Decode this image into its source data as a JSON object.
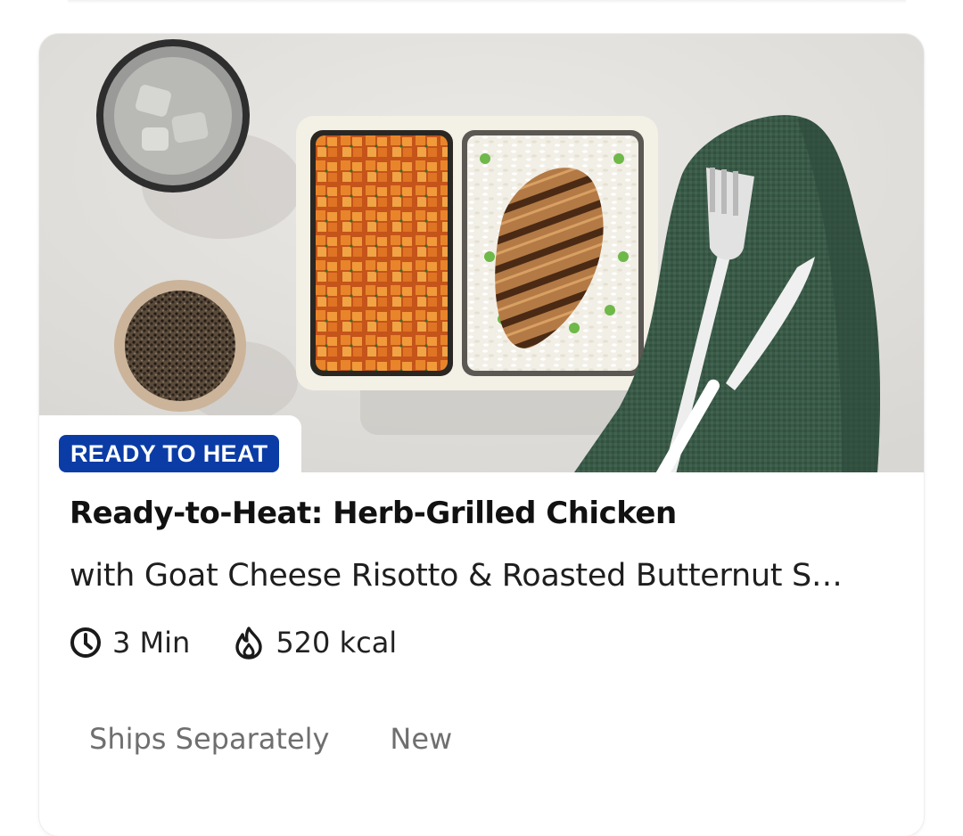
{
  "card": {
    "badge": "READY TO HEAT",
    "title": "Ready-to-Heat: Herb-Grilled Chicken",
    "subtitle": "with Goat Cheese Risotto & Roasted Butternut S…",
    "prep_time": "3 Min",
    "calories": "520 kcal",
    "prep_time_icon": "clock-icon",
    "calories_icon": "flame-icon",
    "tags": [
      "Ships Separately",
      "New"
    ],
    "image_description": "meal-photo"
  },
  "colors": {
    "badge_background": "#0b3ca6",
    "badge_text": "#ffffff",
    "title": "#111111",
    "tag_text": "#6f6f6f"
  }
}
